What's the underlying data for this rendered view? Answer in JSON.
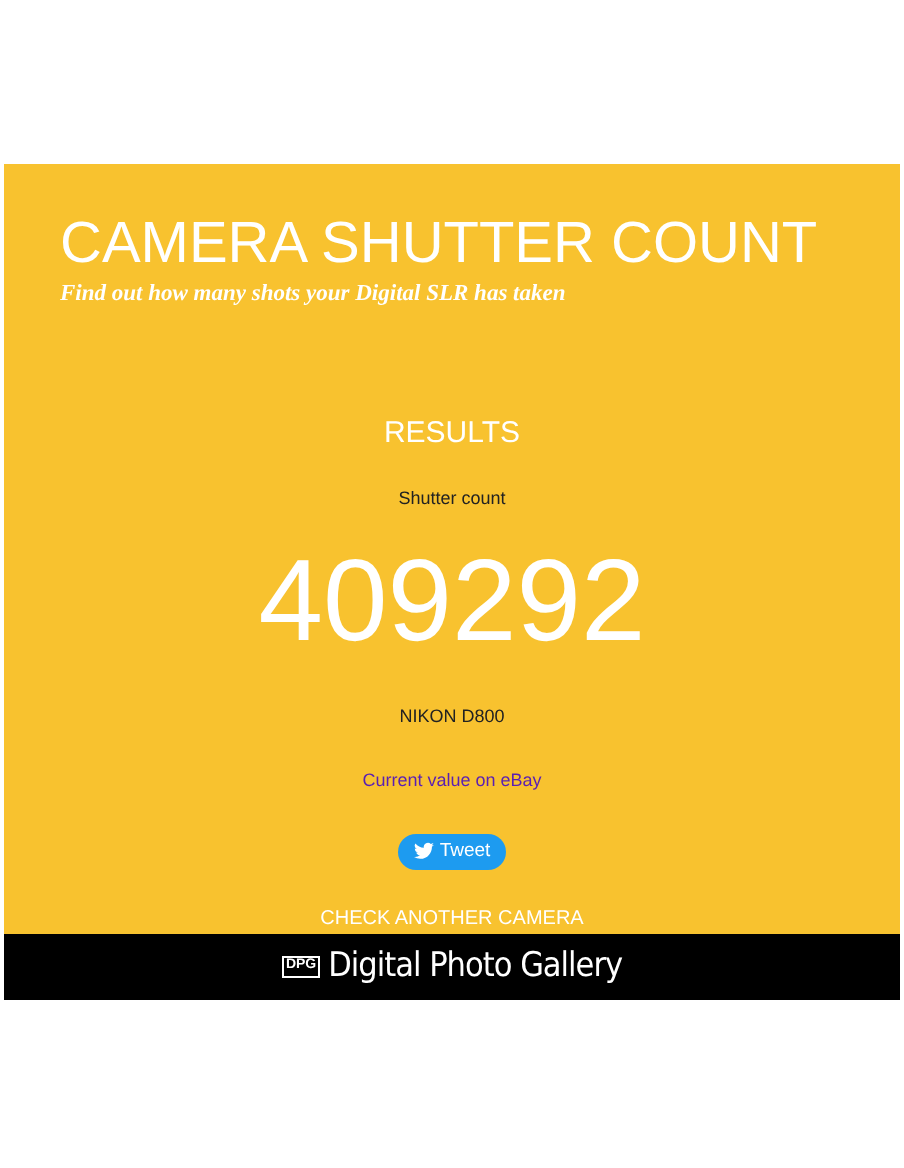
{
  "header": {
    "title": "CAMERA SHUTTER COUNT",
    "subtitle": "Find out how many shots your Digital SLR has taken"
  },
  "results": {
    "heading": "RESULTS",
    "label": "Shutter count",
    "count": "409292",
    "camera": "NIKON D800",
    "ebay_link": "Current value on eBay",
    "tweet_button": "Tweet",
    "check_link": "CHECK ANOTHER CAMERA"
  },
  "footer": {
    "logo_mark": "DPG",
    "logo_text": "Digital Photo Gallery"
  }
}
